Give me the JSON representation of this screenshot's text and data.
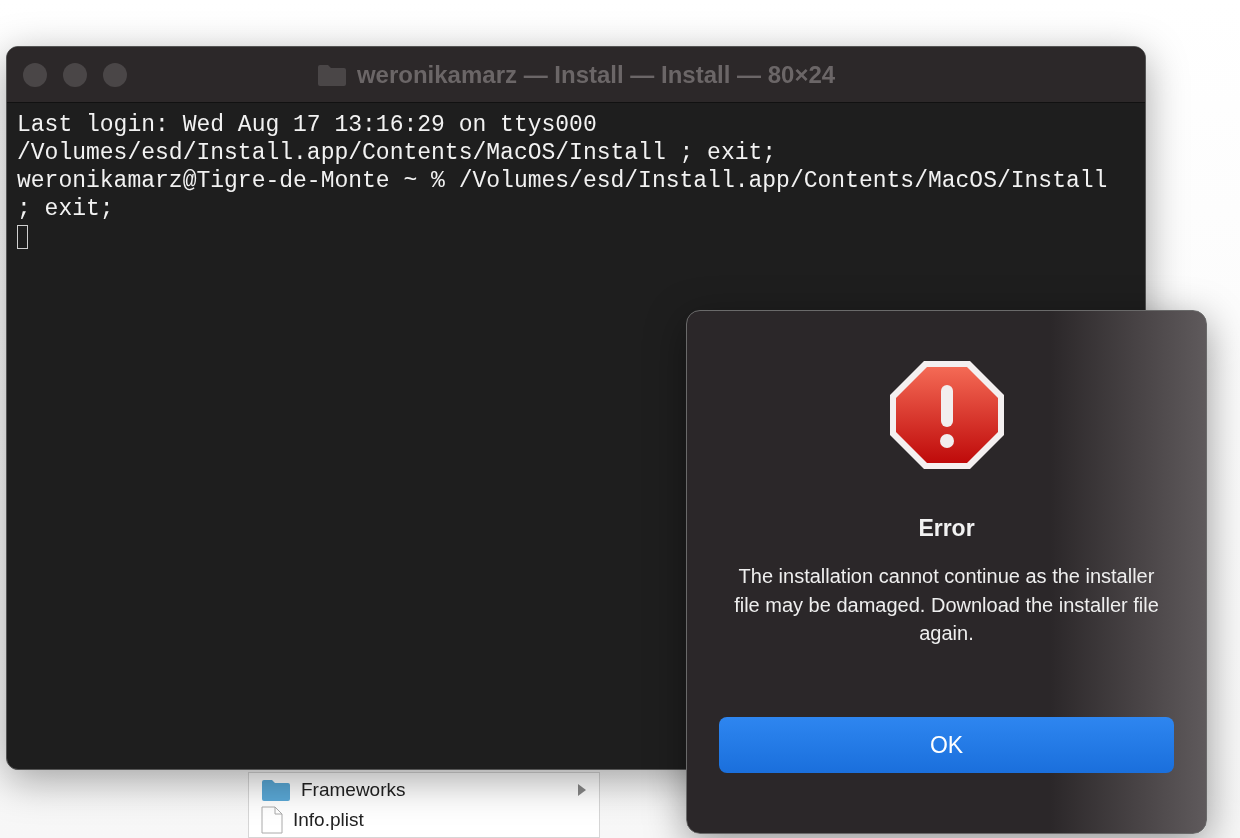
{
  "finder": {
    "items": [
      {
        "name": "Frameworks",
        "kind": "folder"
      },
      {
        "name": "Info.plist",
        "kind": "file"
      }
    ]
  },
  "terminal": {
    "title": "weronikamarz — Install — Install — 80×24",
    "lines": [
      "Last login: Wed Aug 17 13:16:29 on ttys000",
      "/Volumes/esd/Install.app/Contents/MacOS/Install ; exit;",
      "weronikamarz@Tigre-de-Monte ~ % /Volumes/esd/Install.app/Contents/MacOS/Install",
      "; exit;"
    ]
  },
  "dialog": {
    "title": "Error",
    "message": "The installation cannot continue as the installer file may be damaged. Download the installer file again.",
    "button": "OK"
  }
}
